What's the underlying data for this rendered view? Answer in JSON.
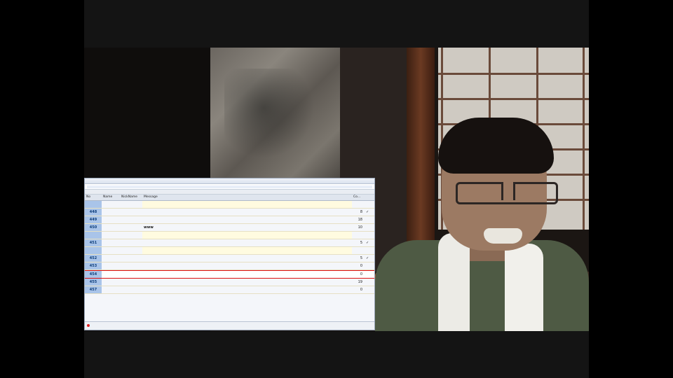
{
  "window": {
    "title": "",
    "url": "",
    "tab": "",
    "status_right": ""
  },
  "table": {
    "headers": [
      "No",
      "Name",
      "NickName",
      "Message",
      "Co...",
      ""
    ],
    "rows": [
      {
        "no": "",
        "name": "",
        "nick": "",
        "msg": "",
        "count": "",
        "check": "",
        "sys": true
      },
      {
        "no": "448",
        "name": "",
        "nick": "",
        "msg": "",
        "count": "8",
        "check": "✓",
        "sys": false
      },
      {
        "no": "449",
        "name": "",
        "nick": "",
        "msg": "",
        "count": "18",
        "check": "",
        "sys": false
      },
      {
        "no": "450",
        "name": "",
        "nick": "",
        "msg": "www",
        "count": "10",
        "check": "",
        "sys": false
      },
      {
        "no": "",
        "name": "",
        "nick": "",
        "msg": "",
        "count": "",
        "check": "",
        "sys": true
      },
      {
        "no": "451",
        "name": "",
        "nick": "",
        "msg": "",
        "count": "5",
        "check": "✓",
        "sys": false
      },
      {
        "no": "",
        "name": "",
        "nick": "",
        "msg": "",
        "count": "",
        "check": "",
        "sys": true
      },
      {
        "no": "452",
        "name": "",
        "nick": "",
        "msg": "",
        "count": "5",
        "check": "✓",
        "sys": false
      },
      {
        "no": "453",
        "name": "",
        "nick": "",
        "msg": "",
        "count": "0",
        "check": "",
        "sys": false
      },
      {
        "no": "454",
        "name": "",
        "nick": "",
        "msg": "",
        "count": "0",
        "check": "",
        "sys": false
      },
      {
        "no": "455",
        "name": "",
        "nick": "",
        "msg": "",
        "count": "19",
        "check": "",
        "sys": false
      },
      {
        "no": "457",
        "name": "",
        "nick": "",
        "msg": "",
        "count": "0",
        "check": "",
        "sys": false
      }
    ]
  }
}
